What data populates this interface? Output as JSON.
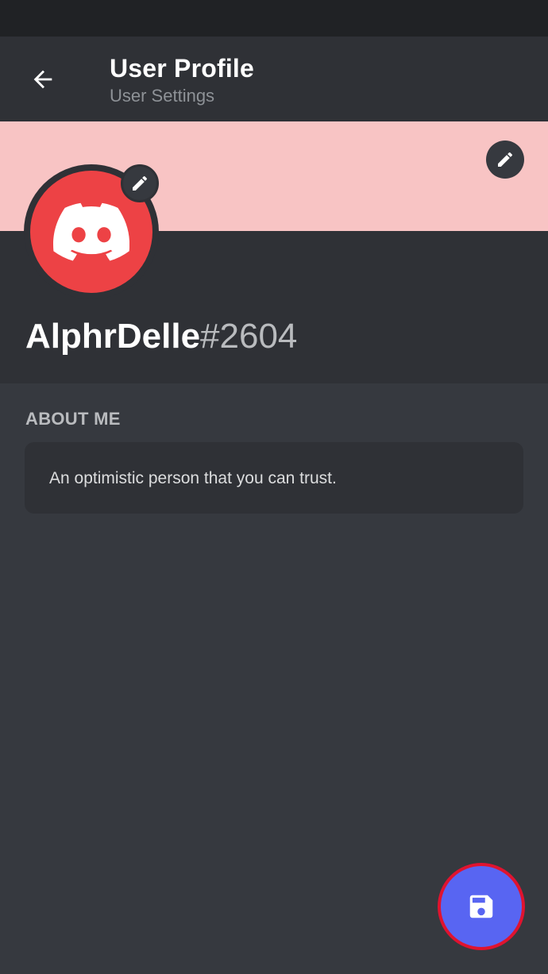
{
  "header": {
    "title": "User Profile",
    "subtitle": "User Settings",
    "back_icon": "arrow-left-icon"
  },
  "profile": {
    "banner_color": "#f8c4c4",
    "avatar_color": "#ed4245",
    "avatar_icon": "discord-logo-icon",
    "edit_icon": "pencil-icon",
    "username": "AlphrDelle",
    "discriminator": "#2604"
  },
  "about": {
    "label": "ABOUT ME",
    "text": "An optimistic person that you can trust."
  },
  "fab": {
    "icon": "floppy-disk-icon",
    "color": "#5865f2"
  },
  "colors": {
    "background": "#36393f",
    "header": "#2f3136",
    "status_bar": "#202225",
    "highlight_ring": "#e0132f"
  }
}
